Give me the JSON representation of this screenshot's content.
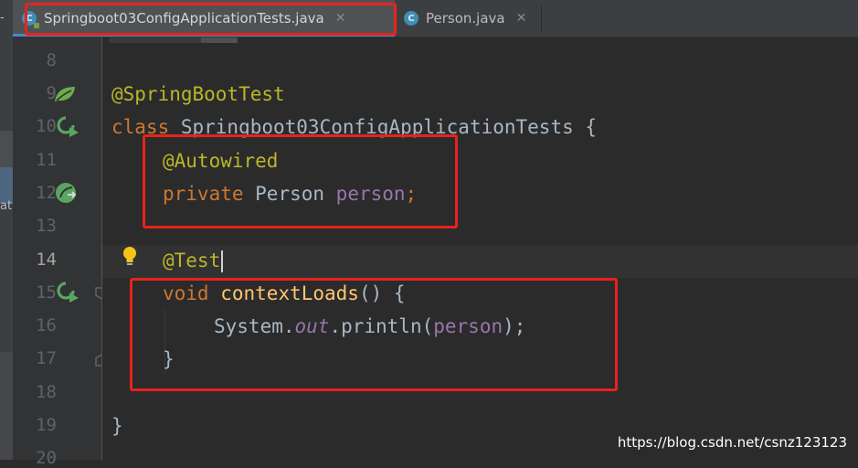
{
  "tabs": [
    {
      "label": "Springboot03ConfigApplicationTests.java",
      "icon": "java-class-icon",
      "active": true
    },
    {
      "label": "Person.java",
      "icon": "java-class-icon",
      "active": false
    }
  ],
  "left_panel": {
    "menu_glyph": "-",
    "fragment": "at"
  },
  "gutter": {
    "line_numbers": [
      "8",
      "9",
      "10",
      "11",
      "12",
      "13",
      "14",
      "15",
      "16",
      "17",
      "18",
      "19",
      "20"
    ],
    "current_line": "14"
  },
  "code": {
    "annotation_springboottest": "@SpringBootTest",
    "kw_class": "class",
    "class_decl": " Springboot03ConfigApplicationTests {",
    "annotation_autowired": "@Autowired",
    "kw_private": "private",
    "type_person": " Person ",
    "field_person": "person",
    "semicolon": ";",
    "annotation_test": "@Test",
    "kw_void": "void",
    "method_name": "contextLoads",
    "method_rest": "() {",
    "sys": "System.",
    "out": "out",
    "println": ".println(",
    "arg_person": "person",
    "close_call": ");",
    "close_brace_method": "}",
    "close_brace_class": "}"
  },
  "watermark": "https://blog.csdn.net/csnz123123",
  "colors": {
    "keyword": "#cc7832",
    "annotation": "#bbb529",
    "field": "#9876aa",
    "method": "#ffc66d",
    "highlight_box": "#e6231e"
  }
}
